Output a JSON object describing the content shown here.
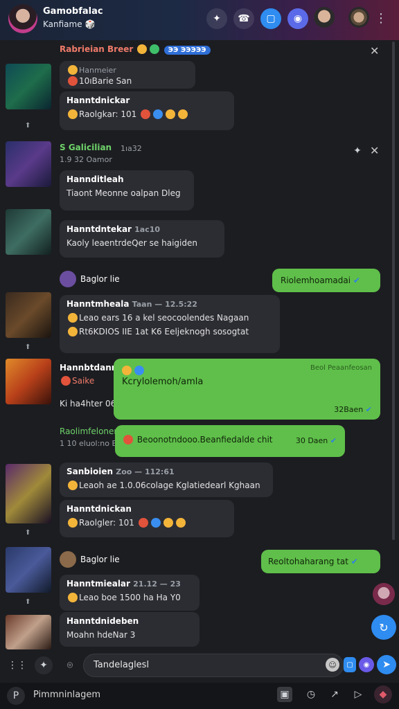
{
  "header": {
    "title": "Gamobfalac",
    "subtitle": "Kanfiame",
    "subtitle_emoji": "🎲"
  },
  "pinned_bar": {
    "name": "Rabrieian Breer",
    "tag": "ЭЭ ЭЭЭЭЭ"
  },
  "messages": [
    {
      "top_line": "Hanmeier",
      "line": "10ıBarie San"
    },
    {
      "name": "Hanntdnickar",
      "line": "Raolgkar: 101"
    },
    {
      "name": "S Galicilian",
      "meta": "1ıa32",
      "line2": "1.9 32 Oamor"
    },
    {
      "name": "Hannditleah",
      "line": "Tiaont Meonne oalpan Dleg"
    },
    {
      "name": "Hanntdntekar",
      "meta": "1ac10",
      "line": "Kaoly leaentrdeQer se haigiden"
    },
    {
      "name": "Baglor lie"
    },
    {
      "name": "Hanntmheala",
      "meta": "Taan — 12.5:22",
      "line": "Leao ears 16 a kel seocoolendes Nagaan",
      "line2": "Rt6KDIOS IIE 1at K6 Eeljeknogh sosogtat"
    },
    {
      "name": "Hannbtdanr",
      "line": "Saike",
      "line2": "Ki ha4hter 06"
    },
    {
      "name": "Raolimfeloner",
      "line": "1 10 eluol:no B6"
    },
    {
      "name": "Sanbioien",
      "meta": "Zoo — 112:61",
      "line": "Leaoh ae 1.0.06colage Kglatiedearl Kghaan"
    },
    {
      "name": "Hanntdnickan",
      "line": "Raolgler: 101"
    },
    {
      "name": "Baglor lie"
    },
    {
      "name": "Hanntmiealar",
      "meta": "21.12 — 23",
      "line": "Leao boe 1500 ha Ha Y0"
    },
    {
      "name": "Hanntdnideben",
      "line": "Moahn hdeNar 3"
    }
  ],
  "outgoing": [
    {
      "text": "Riolemhoamadai"
    },
    {
      "text": "Kcrylolemoh/amla",
      "time_label": "Beol Peaanfeosan",
      "time": "32Baen"
    },
    {
      "text": "Beoonotndooo.Beanfiedalde chit",
      "time": "30 Daen"
    },
    {
      "text": "Reoltohaharang tat"
    }
  ],
  "input": {
    "placeholder": "Tandelaglesl"
  },
  "bottom": {
    "label": "Pimmninlagem"
  },
  "colors": {
    "accent": "#2f8cf0",
    "outgoing_bubble": "#5fbf4a",
    "incoming_bubble": "#2c2d33",
    "background": "#1c1d21"
  }
}
